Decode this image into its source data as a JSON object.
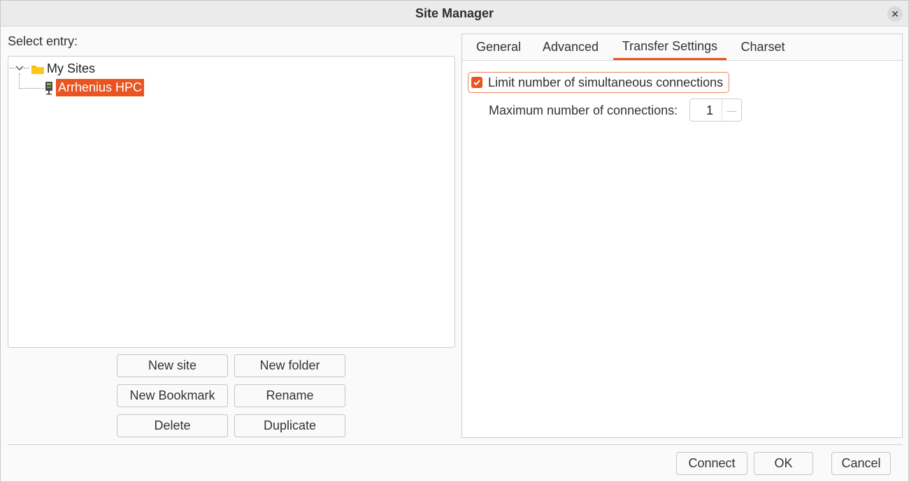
{
  "window": {
    "title": "Site Manager"
  },
  "left": {
    "select_label": "Select entry:",
    "tree": {
      "folder": "My Sites",
      "site": "Arrhenius HPC"
    },
    "buttons": {
      "new_site": "New site",
      "new_folder": "New folder",
      "new_bookmark": "New Bookmark",
      "rename": "Rename",
      "delete": "Delete",
      "duplicate": "Duplicate"
    }
  },
  "tabs": [
    "General",
    "Advanced",
    "Transfer Settings",
    "Charset"
  ],
  "active_tab": "Transfer Settings",
  "transfer": {
    "limit_label": "Limit number of simultaneous connections",
    "limit_checked": true,
    "max_label": "Maximum number of connections:",
    "max_value": "1"
  },
  "footer": {
    "connect": "Connect",
    "ok": "OK",
    "cancel": "Cancel"
  },
  "colors": {
    "accent": "#e95420",
    "folder": "#f5b900"
  }
}
